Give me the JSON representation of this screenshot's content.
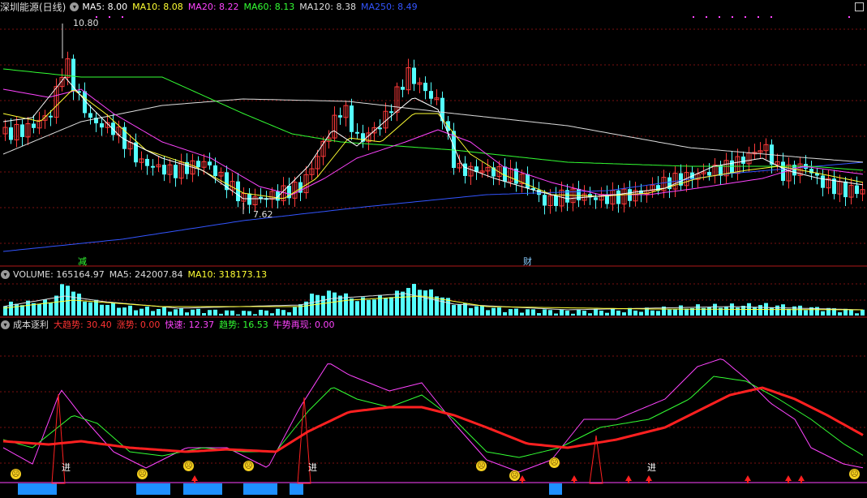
{
  "main_panel": {
    "title": "深圳能源(日线)",
    "indicators": [
      {
        "label": "MA5: 8.00",
        "color": "#ffffff"
      },
      {
        "label": "MA10: 8.08",
        "color": "#ffff33"
      },
      {
        "label": "MA20: 8.22",
        "color": "#ff44ff"
      },
      {
        "label": "MA60: 8.13",
        "color": "#33ff33"
      },
      {
        "label": "MA120: 8.38",
        "color": "#dddddd"
      },
      {
        "label": "MA250: 8.49",
        "color": "#3355ff"
      }
    ],
    "high_label": "10.80",
    "low_label": "7.62",
    "event_labels": [
      "减",
      "财"
    ]
  },
  "volume_panel": {
    "indicators": [
      {
        "label": "VOLUME: 165164.97",
        "color": "#dddddd"
      },
      {
        "label": "MA5: 242007.84",
        "color": "#dddddd"
      },
      {
        "label": "MA10: 318173.13",
        "color": "#ffff33"
      }
    ]
  },
  "indicator_panel": {
    "indicators": [
      {
        "label": "成本逐利",
        "color": "#dddddd"
      },
      {
        "label": "大趋势: 30.40",
        "color": "#ff3333"
      },
      {
        "label": "涨势: 0.00",
        "color": "#ff3333"
      },
      {
        "label": "快速: 12.37",
        "color": "#ff44ff"
      },
      {
        "label": "趋势: 16.53",
        "color": "#33ff33"
      },
      {
        "label": "牛势再现: 0.00",
        "color": "#ff44ff"
      }
    ],
    "signal_labels": [
      "进",
      "进",
      "进"
    ]
  },
  "colors": {
    "up": "#ff3b3b",
    "down": "#54ffff",
    "grid": "#7a1010",
    "separator": "#b01818"
  },
  "icons": [
    "circle-arrow-icon",
    "maximize-icon",
    "sad-face-icon",
    "up-arrow-icon"
  ]
}
